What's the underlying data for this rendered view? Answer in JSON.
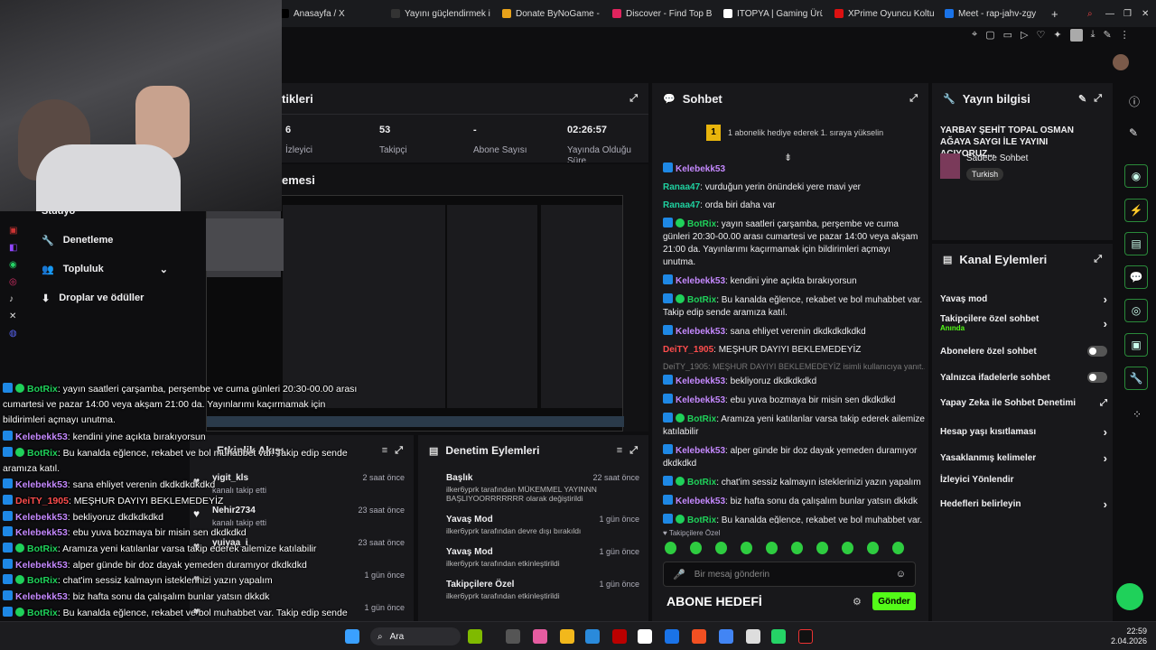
{
  "browser": {
    "tabs": [
      {
        "label": "Anasayfa / X",
        "color": "#000000"
      },
      {
        "label": "Yayını güçlendirmek iç",
        "color": "#333333"
      },
      {
        "label": "Donate ByNoGame - Ak",
        "color": "#e8a21a"
      },
      {
        "label": "Discover - Find Top Blen",
        "color": "#e0245e"
      },
      {
        "label": "ITOPYA | Gaming Ürünle",
        "color": "#ffffff"
      },
      {
        "label": "XPrime Oyuncu Koltuğ",
        "color": "#d11"
      },
      {
        "label": "Meet - rap-jahv-zgy",
        "color": "#1a73e8"
      }
    ],
    "new_tab": "+"
  },
  "stats_panel": {
    "title": "tikleri",
    "stats": [
      {
        "value": "6",
        "label": "İzleyici"
      },
      {
        "value": "53",
        "label": "Takipçi"
      },
      {
        "value": "-",
        "label": "Abone Sayısı"
      },
      {
        "value": "02:26:57",
        "label": "Yayında Olduğu Süre"
      }
    ]
  },
  "preview_panel": {
    "title": "emesi"
  },
  "left_nav": {
    "items": [
      {
        "label": "Stüdyo"
      },
      {
        "label": "Denetleme"
      },
      {
        "label": "Topluluk"
      },
      {
        "label": "Droplar ve ödüller"
      }
    ]
  },
  "activity_feed": {
    "title": "Etkinlik Akışı",
    "rows": [
      {
        "name": "yigit_kls",
        "action": "kanalı takip etti",
        "time": "2 saat önce"
      },
      {
        "name": "Nehir2734",
        "action": "kanalı takip etti",
        "time": "23 saat önce"
      },
      {
        "name": "yuiyaa_i",
        "action": "",
        "time": "23 saat önce"
      },
      {
        "name": "",
        "action": "",
        "time": "1 gün önce"
      },
      {
        "name": "",
        "action": "",
        "time": "1 gün önce"
      }
    ]
  },
  "mod_actions": {
    "title": "Denetim Eylemleri",
    "rows": [
      {
        "title": "Başlık",
        "line1": "ilker6yprk tarafından MÜKEMMEL YAYINNN BAŞLIYOORRRRRRR olarak değiştirildi",
        "time": "22 saat önce"
      },
      {
        "title": "Yavaş Mod",
        "line1": "ilker6yprk tarafından devre dışı bırakıldı",
        "time": "1 gün önce"
      },
      {
        "title": "Yavaş Mod",
        "line1": "ilker6yprk tarafından etkinleştirildi",
        "time": "1 gün önce"
      },
      {
        "title": "Takipçilere Özel",
        "line1": "ilker6yprk tarafından etkinleştirildi",
        "time": "1 gün önce"
      }
    ]
  },
  "chat": {
    "title": "Sohbet",
    "hype": "1 abonelik hediye ederek 1. sıraya yükselin",
    "messages": [
      {
        "user": "Kelebekk53",
        "cls": "kel",
        "text": ""
      },
      {
        "user": "Ranaa47",
        "cls": "ran",
        "text": ": vurduğun yerin önündeki yere mavi yer"
      },
      {
        "user": "Ranaa47",
        "cls": "ran",
        "text": ": orda biri daha var"
      },
      {
        "user": "BotRix",
        "cls": "bot",
        "text": ": yayın saatleri çarşamba, perşembe ve cuma günleri 20:30-00.00 arası cumartesi ve pazar 14:00 veya akşam 21:00 da. Yayınlarımı kaçırmamak için bildirimleri açmayı unutma."
      },
      {
        "user": "Kelebekk53",
        "cls": "kel",
        "text": ": kendini yine açıkta bırakıyorsun"
      },
      {
        "user": "BotRix",
        "cls": "bot",
        "text": ": Bu kanalda eğlence, rekabet ve bol muhabbet var. Takip edip sende aramıza katıl."
      },
      {
        "user": "Kelebekk53",
        "cls": "kel",
        "text": ": sana ehliyet verenin dkdkdkdkdkd"
      },
      {
        "user": "DeiTY_1905",
        "cls": "dei",
        "text": ": MEŞHUR DAYIYI BEKLEMEDEYİZ"
      }
    ],
    "reply_hint": "DeiTY_1905: MEŞHUR DAYIYI BEKLEMEDEYİZ isimli kullanıcıya yanıt...",
    "messages2": [
      {
        "user": "Kelebekk53",
        "cls": "kel",
        "text": ": bekliyoruz dkdkdkdkd"
      },
      {
        "user": "Kelebekk53",
        "cls": "kel",
        "text": ": ebu yuva bozmaya bir misin sen dkdkdkd"
      },
      {
        "user": "BotRix",
        "cls": "bot",
        "text": ": Aramıza yeni katılanlar varsa takip ederek ailemize katılabilir"
      },
      {
        "user": "Kelebekk53",
        "cls": "kel",
        "text": ": alper günde bir doz dayak yemeden duramıyor dkdkdkd"
      },
      {
        "user": "BotRix",
        "cls": "bot",
        "text": ": chat'im sessiz kalmayın isteklerinizi yazın yapalım"
      },
      {
        "user": "Kelebekk53",
        "cls": "kel",
        "text": ": biz hafta sonu da çalışalım bunlar yatsın dkkdk"
      },
      {
        "user": "BotRix",
        "cls": "bot",
        "text": ": Bu kanalda eğlence, rekabet ve bol muhabbet var. Takip edip sende aramıza katıl."
      }
    ],
    "followers_label": "Takipçilere Özel",
    "input_placeholder": "Bir mesaj gönderin",
    "send_label": "Gönder",
    "overlay_text": "ABONE HEDEFİ"
  },
  "stream_info": {
    "title": "Yayın bilgisi",
    "stream_title": "YARBAY ŞEHİT TOPAL OSMAN AĞAYA SAYGI İLE YAYINI AÇIYORUZ...",
    "category": "Sadece Sohbet",
    "tag": "Turkish"
  },
  "channel_actions": {
    "title": "Kanal Eylemleri",
    "items": [
      {
        "label": "Yavaş mod",
        "sub": "",
        "ctrl": "chevron"
      },
      {
        "label": "Takipçilere özel sohbet",
        "sub": "Anında",
        "ctrl": "chevron"
      },
      {
        "label": "Abonelere özel sohbet",
        "sub": "",
        "ctrl": "toggle"
      },
      {
        "label": "Yalnızca ifadelerle sohbet",
        "sub": "",
        "ctrl": "toggle"
      },
      {
        "label": "Yapay Zeka ile Sohbet Denetimi",
        "sub": "",
        "ctrl": "ext"
      },
      {
        "label": "Hesap yaşı kısıtlaması",
        "sub": "",
        "ctrl": "chevron"
      },
      {
        "label": "Yasaklanmış kelimeler",
        "sub": "",
        "ctrl": "chevron"
      },
      {
        "label": "İzleyici Yönlendir",
        "sub": "",
        "ctrl": ""
      },
      {
        "label": "Hedefleri belirleyin",
        "sub": "",
        "ctrl": "chevron"
      }
    ]
  },
  "overlay_chat": [
    {
      "user": "BotRix",
      "cls": "bot",
      "text": ": yayın saatleri çarşamba, perşembe ve cuma günleri 20:30-00.00 arası"
    },
    {
      "user": "",
      "cls": "",
      "text": "cumartesi ve pazar 14:00 veya akşam 21:00 da. Yayınlarımı kaçırmamak için"
    },
    {
      "user": "",
      "cls": "",
      "text": "bildirimleri açmayı unutma."
    },
    {
      "user": "Kelebekk53",
      "cls": "kel",
      "text": ": kendini yine açıkta bırakıyorsun"
    },
    {
      "user": "BotRix",
      "cls": "bot",
      "text": ": Bu kanalda eğlence, rekabet ve bol muhabbet var. Takip edip sende"
    },
    {
      "user": "",
      "cls": "",
      "text": "aramıza katıl."
    },
    {
      "user": "Kelebekk53",
      "cls": "kel",
      "text": ": sana ehliyet verenin dkdkdkdkdkd"
    },
    {
      "user": "DeiTY_1905",
      "cls": "dei",
      "text": ": MEŞHUR DAYIYI BEKLEMEDEYİZ"
    },
    {
      "user": "Kelebekk53",
      "cls": "kel",
      "text": ": bekliyoruz dkdkdkdkd"
    },
    {
      "user": "Kelebekk53",
      "cls": "kel",
      "text": ": ebu yuva bozmaya bir misin sen dkdkdkd"
    },
    {
      "user": "BotRix",
      "cls": "bot",
      "text": ": Aramıza yeni katılanlar varsa takip ederek ailemize katılabilir"
    },
    {
      "user": "Kelebekk53",
      "cls": "kel",
      "text": ": alper günde bir doz dayak yemeden duramıyor dkdkdkd"
    },
    {
      "user": "BotRix",
      "cls": "bot",
      "text": ": chat'im sessiz kalmayın isteklerinizi yazın yapalım"
    },
    {
      "user": "Kelebekk53",
      "cls": "kel",
      "text": ": biz hafta sonu da çalışalım bunlar yatsın dkkdk"
    },
    {
      "user": "BotRix",
      "cls": "bot",
      "text": ": Bu kanalda eğlence, rekabet ve bol muhabbet var. Takip edip sende"
    },
    {
      "user": "",
      "cls": "",
      "text": "aramıza katıl."
    }
  ],
  "taskbar": {
    "search_placeholder": "Ara",
    "time": "22:59",
    "date": "2.04.2026"
  },
  "colors": {
    "accent": "#53fc18",
    "bg": "#0e0e10",
    "panel": "#18181b"
  }
}
